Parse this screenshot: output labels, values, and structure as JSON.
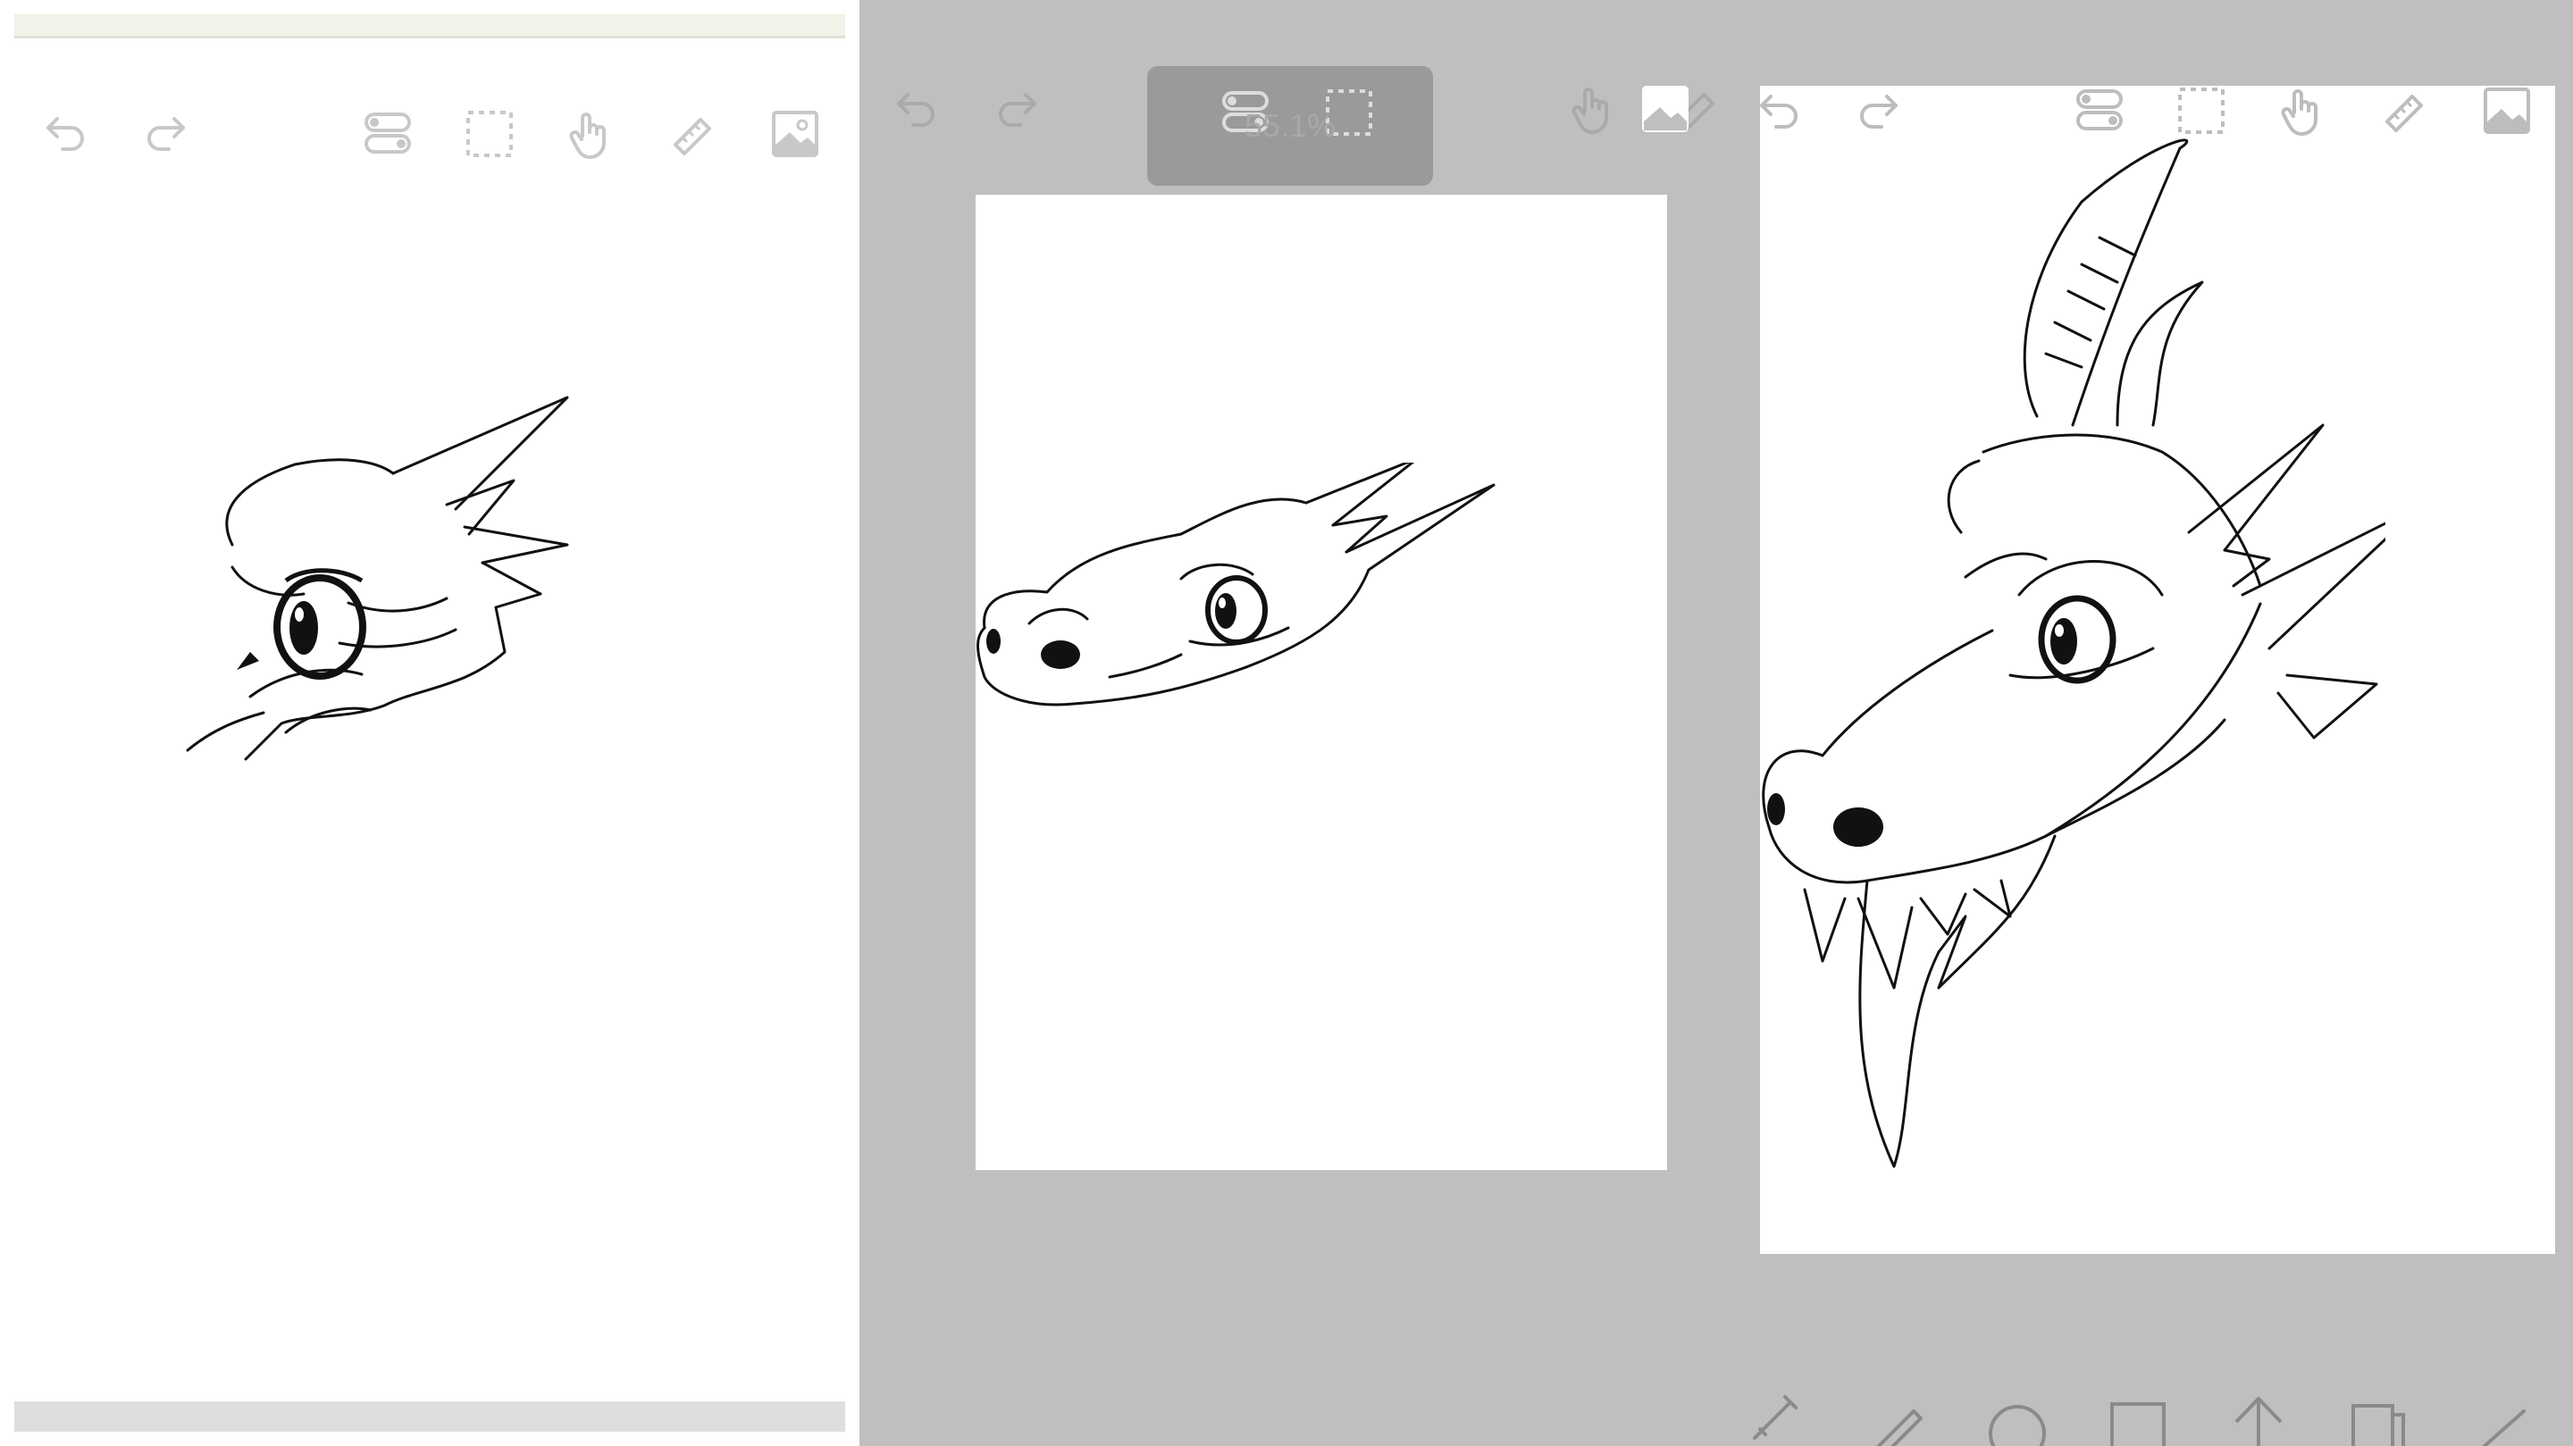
{
  "panels": [
    {
      "id": "panel-1",
      "toolbar": [
        "undo-icon",
        "redo-icon",
        "layers-icon",
        "selection-icon",
        "hand-icon",
        "ruler-icon",
        "image-icon"
      ]
    },
    {
      "id": "panel-2",
      "toolbar": [
        "undo-icon",
        "redo-icon",
        "layers-icon",
        "selection-icon",
        "hand-icon",
        "ruler-icon",
        "image-icon"
      ],
      "zoom_indicator": "55.1%"
    },
    {
      "id": "panel-3",
      "toolbar": [
        "undo-icon",
        "redo-icon",
        "layers-icon",
        "selection-icon",
        "hand-icon",
        "ruler-icon",
        "image-icon"
      ],
      "bottom_toolbar": [
        "brush-icon",
        "pen-icon",
        "ellipse-icon",
        "rectangle-icon",
        "arrow-up-icon",
        "copy-icon",
        "line-icon"
      ]
    }
  ],
  "colors": {
    "workspace_gray": "#bfbfbf",
    "canvas_white": "#ffffff",
    "icon_gray": "#c8c8c8",
    "ink": "#111111"
  }
}
